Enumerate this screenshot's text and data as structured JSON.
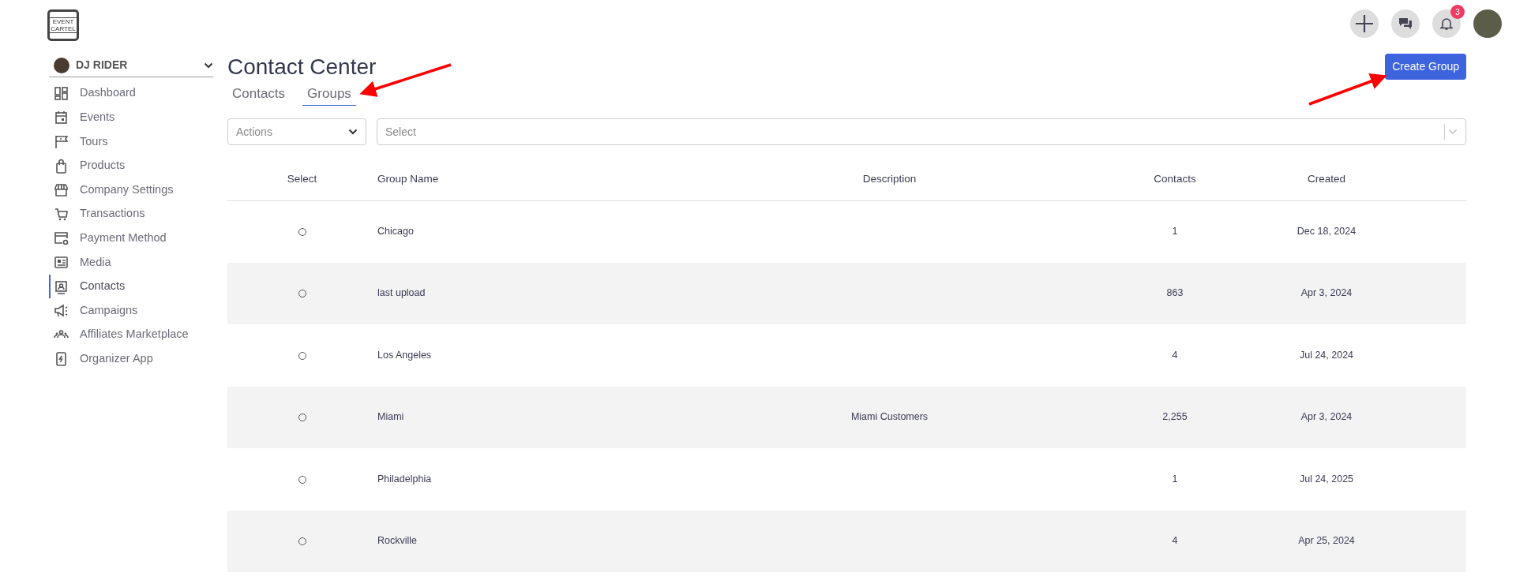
{
  "logo": {
    "line_1": "EVENT",
    "line_2": "CARTEL"
  },
  "header": {
    "notification_count": "3"
  },
  "account": {
    "name": "DJ RIDER"
  },
  "sidebar": {
    "items": [
      {
        "label": "Dashboard",
        "selected": false
      },
      {
        "label": "Events",
        "selected": false
      },
      {
        "label": "Tours",
        "selected": false
      },
      {
        "label": "Products",
        "selected": false
      },
      {
        "label": "Company Settings",
        "selected": false
      },
      {
        "label": "Transactions",
        "selected": false
      },
      {
        "label": "Payment Method",
        "selected": false
      },
      {
        "label": "Media",
        "selected": false
      },
      {
        "label": "Contacts",
        "selected": true
      },
      {
        "label": "Campaigns",
        "selected": false
      },
      {
        "label": "Affiliates Marketplace",
        "selected": false
      },
      {
        "label": "Organizer App",
        "selected": false
      }
    ]
  },
  "page": {
    "title": "Contact Center",
    "primary_button": "Create Group"
  },
  "tabs": [
    {
      "label": "Contacts",
      "selected": false
    },
    {
      "label": "Groups",
      "selected": true
    }
  ],
  "filters": {
    "actions": {
      "placeholder": "Actions"
    },
    "group_select": {
      "placeholder": "Select"
    }
  },
  "table": {
    "columns": [
      "Select",
      "Group Name",
      "Description",
      "Contacts",
      "Created"
    ],
    "rows": [
      {
        "selected": false,
        "name": "Chicago",
        "description": "",
        "contacts": "1",
        "created": "Dec 18, 2024"
      },
      {
        "selected": false,
        "name": "last upload",
        "description": "",
        "contacts": "863",
        "created": "Apr 3, 2024"
      },
      {
        "selected": false,
        "name": "Los Angeles",
        "description": "",
        "contacts": "4",
        "created": "Jul 24, 2024"
      },
      {
        "selected": false,
        "name": "Miami",
        "description": "Miami Customers",
        "contacts": "2,255",
        "created": "Apr 3, 2024"
      },
      {
        "selected": false,
        "name": "Philadelphia",
        "description": "",
        "contacts": "1",
        "created": "Jul 24, 2025"
      },
      {
        "selected": false,
        "name": "Rockville",
        "description": "",
        "contacts": "4",
        "created": "Apr 25, 2024"
      }
    ]
  }
}
